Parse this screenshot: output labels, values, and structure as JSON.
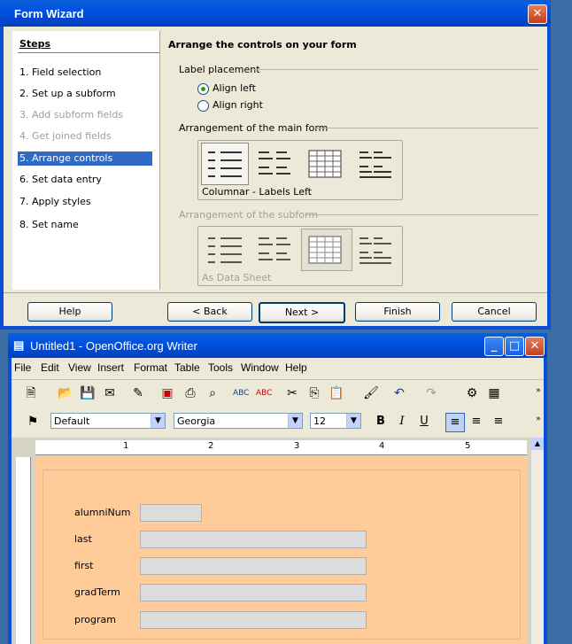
{
  "wizard": {
    "title": "Form Wizard",
    "close_glyph": "✕",
    "steps_header": "Steps",
    "steps": [
      {
        "label": "1.  Field selection",
        "state": "normal"
      },
      {
        "label": "2.  Set up a subform",
        "state": "normal"
      },
      {
        "label": "3.  Add subform fields",
        "state": "disabled"
      },
      {
        "label": "4.  Get joined fields",
        "state": "disabled"
      },
      {
        "label": "5.  Arrange controls",
        "state": "selected"
      },
      {
        "label": "6.  Set data entry",
        "state": "normal"
      },
      {
        "label": "7.  Apply styles",
        "state": "normal"
      },
      {
        "label": "8.  Set name",
        "state": "normal"
      }
    ],
    "heading": "Arrange the controls on your form",
    "label_placement": {
      "title": "Label placement",
      "options": [
        "Align left",
        "Align right"
      ],
      "selected": "Align left"
    },
    "main_form": {
      "title": "Arrangement of the main form",
      "selected_caption": "Columnar - Labels Left"
    },
    "subform": {
      "title": "Arrangement of the subform",
      "selected_caption": "As Data Sheet"
    },
    "buttons": {
      "help": "Help",
      "back": "< Back",
      "next": "Next >",
      "finish": "Finish",
      "cancel": "Cancel"
    }
  },
  "writer": {
    "title": "Untitled1 - OpenOffice.org Writer",
    "window_buttons": [
      "_",
      "□",
      "✕"
    ],
    "menu": [
      "File",
      "Edit",
      "View",
      "Insert",
      "Format",
      "Table",
      "Tools",
      "Window",
      "Help"
    ],
    "style_value": "Default",
    "font_value": "Georgia",
    "size_value": "12",
    "ruler_numbers": [
      "1",
      "2",
      "3",
      "4",
      "5"
    ],
    "fields": [
      "alumniNum",
      "last",
      "first",
      "gradTerm",
      "program"
    ]
  }
}
